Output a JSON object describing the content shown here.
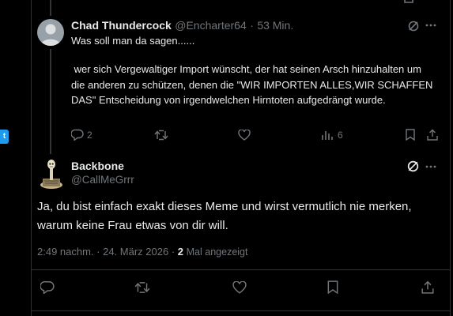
{
  "tweet1": {
    "author_name": "Chad Thundercock",
    "handle": "@Encharter64",
    "separator": "·",
    "time": "53 Min.",
    "line1": "Was soll man da sagen......",
    "body": " wer sich Vergewaltiger Import wünscht, der hat seinen Arsch hinzuhalten um die anderen zu schützen, denen die \"WIR IMPORTEN ALLES,WIR SCHAFFEN DAS\" Entscheidung von irgendwelchen Hirntoten aufgedrängt wurde.",
    "reply_count": "2",
    "views_count": "6"
  },
  "side_tab": {
    "label": "t"
  },
  "tweet2": {
    "author_name": "Backbone",
    "handle": "@CallMeGrrr",
    "text": "Ja, du bist einfach exakt dieses Meme und wirst vermutlich nie merken, warum keine Frau etwas von dir will.",
    "timestamp": "2:49 nachm. · 24. März 2026 ·",
    "views_number": "2",
    "views_label": "Mal angezeigt"
  },
  "colors": {
    "background": "#000000",
    "text": "#e7e9ea",
    "muted": "#71767b",
    "accent": "#1d9bf0",
    "border": "#2f3336"
  }
}
